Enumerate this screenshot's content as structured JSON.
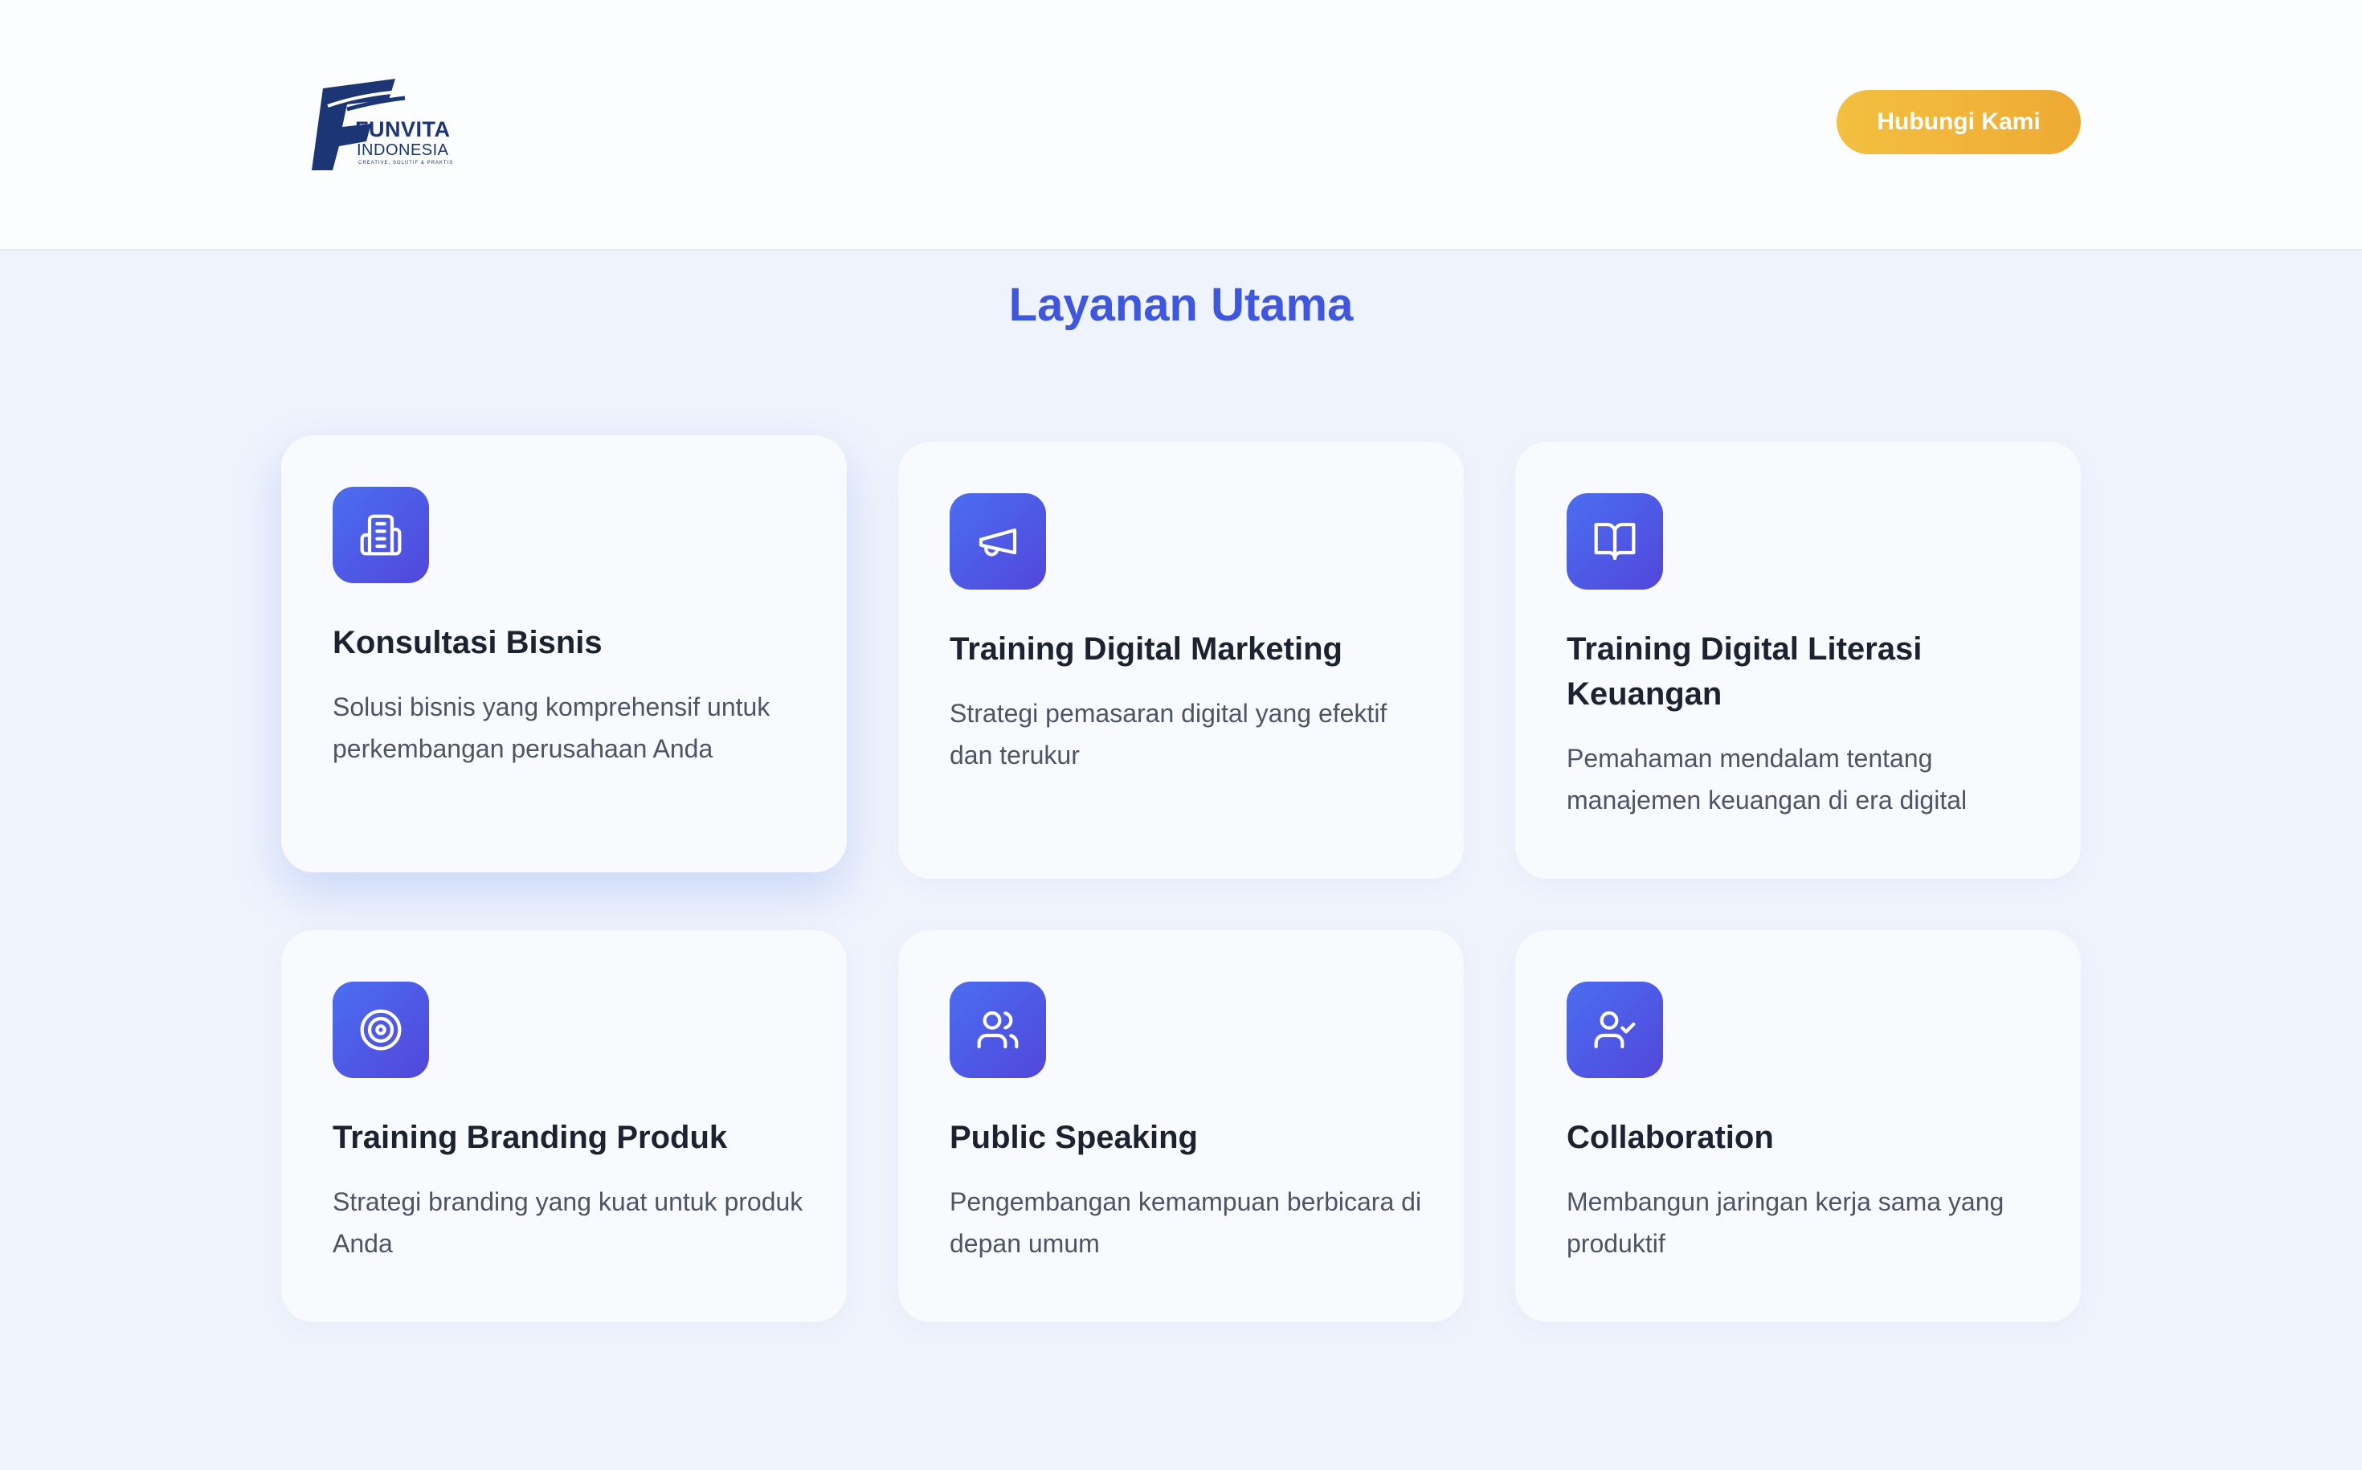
{
  "header": {
    "logo": {
      "name": "FUNVITA",
      "sub": "INDONESIA",
      "tagline": "CREATIVE, SOLUTIF & PRAKTIS"
    },
    "contact_label": "Hubungi Kami"
  },
  "colors": {
    "accent": "#3f57de",
    "button": "#f0b33a",
    "icon_gradient_start": "#4a6ef0",
    "icon_gradient_end": "#5246db"
  },
  "main": {
    "title": "Layanan Utama",
    "services": [
      {
        "icon": "building-icon",
        "title": "Konsultasi Bisnis",
        "description": "Solusi bisnis yang komprehensif untuk perkembangan perusahaan Anda"
      },
      {
        "icon": "megaphone-icon",
        "title": "Training Digital Marketing",
        "description": "Strategi pemasaran digital yang efektif dan terukur"
      },
      {
        "icon": "book-open-icon",
        "title": "Training Digital Literasi Keuangan",
        "description": "Pemahaman mendalam tentang manajemen keuangan di era digital"
      },
      {
        "icon": "target-icon",
        "title": "Training Branding Produk",
        "description": "Strategi branding yang kuat untuk produk Anda"
      },
      {
        "icon": "users-icon",
        "title": "Public Speaking",
        "description": "Pengembangan kemampuan berbicara di depan umum"
      },
      {
        "icon": "user-check-icon",
        "title": "Collaboration",
        "description": "Membangun jaringan kerja sama yang produktif"
      }
    ]
  }
}
